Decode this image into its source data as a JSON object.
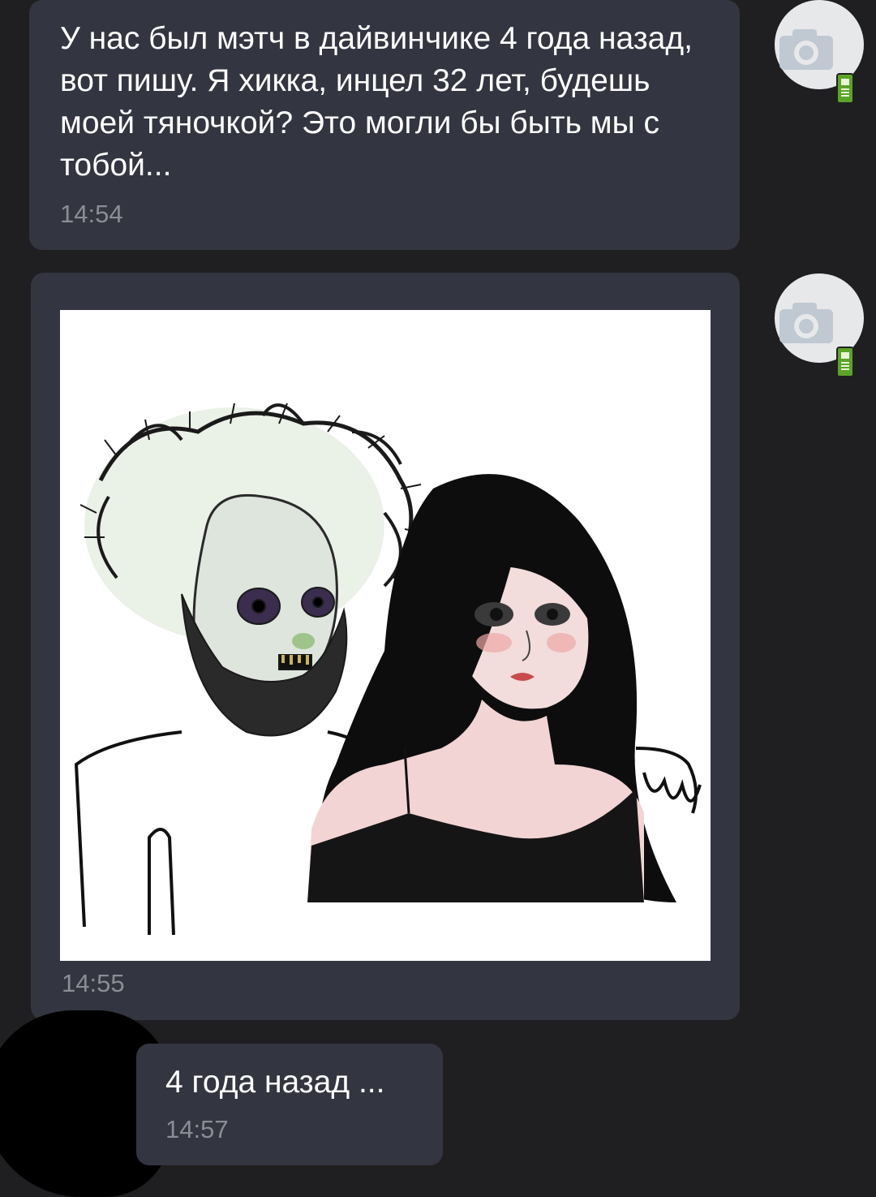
{
  "messages": [
    {
      "text": "У нас был мэтч в дайвинчике 4 года назад, вот пишу. Я хикка, инцел 32 лет, будешь моей тяночкой? Это могли бы быть мы с тобой...",
      "time": "14:54"
    },
    {
      "image": "meme-drawing-bearded-man-and-woman",
      "time": "14:55"
    },
    {
      "text": "4 года назад ...",
      "time": "14:57"
    }
  ],
  "avatar": {
    "icon": "camera-icon",
    "badge": "mobile-phone-icon"
  },
  "colors": {
    "background": "#1f1f21",
    "bubble": "#333540",
    "text": "#ffffff",
    "time": "#8b8d94",
    "phone_badge": "#5aa427"
  }
}
